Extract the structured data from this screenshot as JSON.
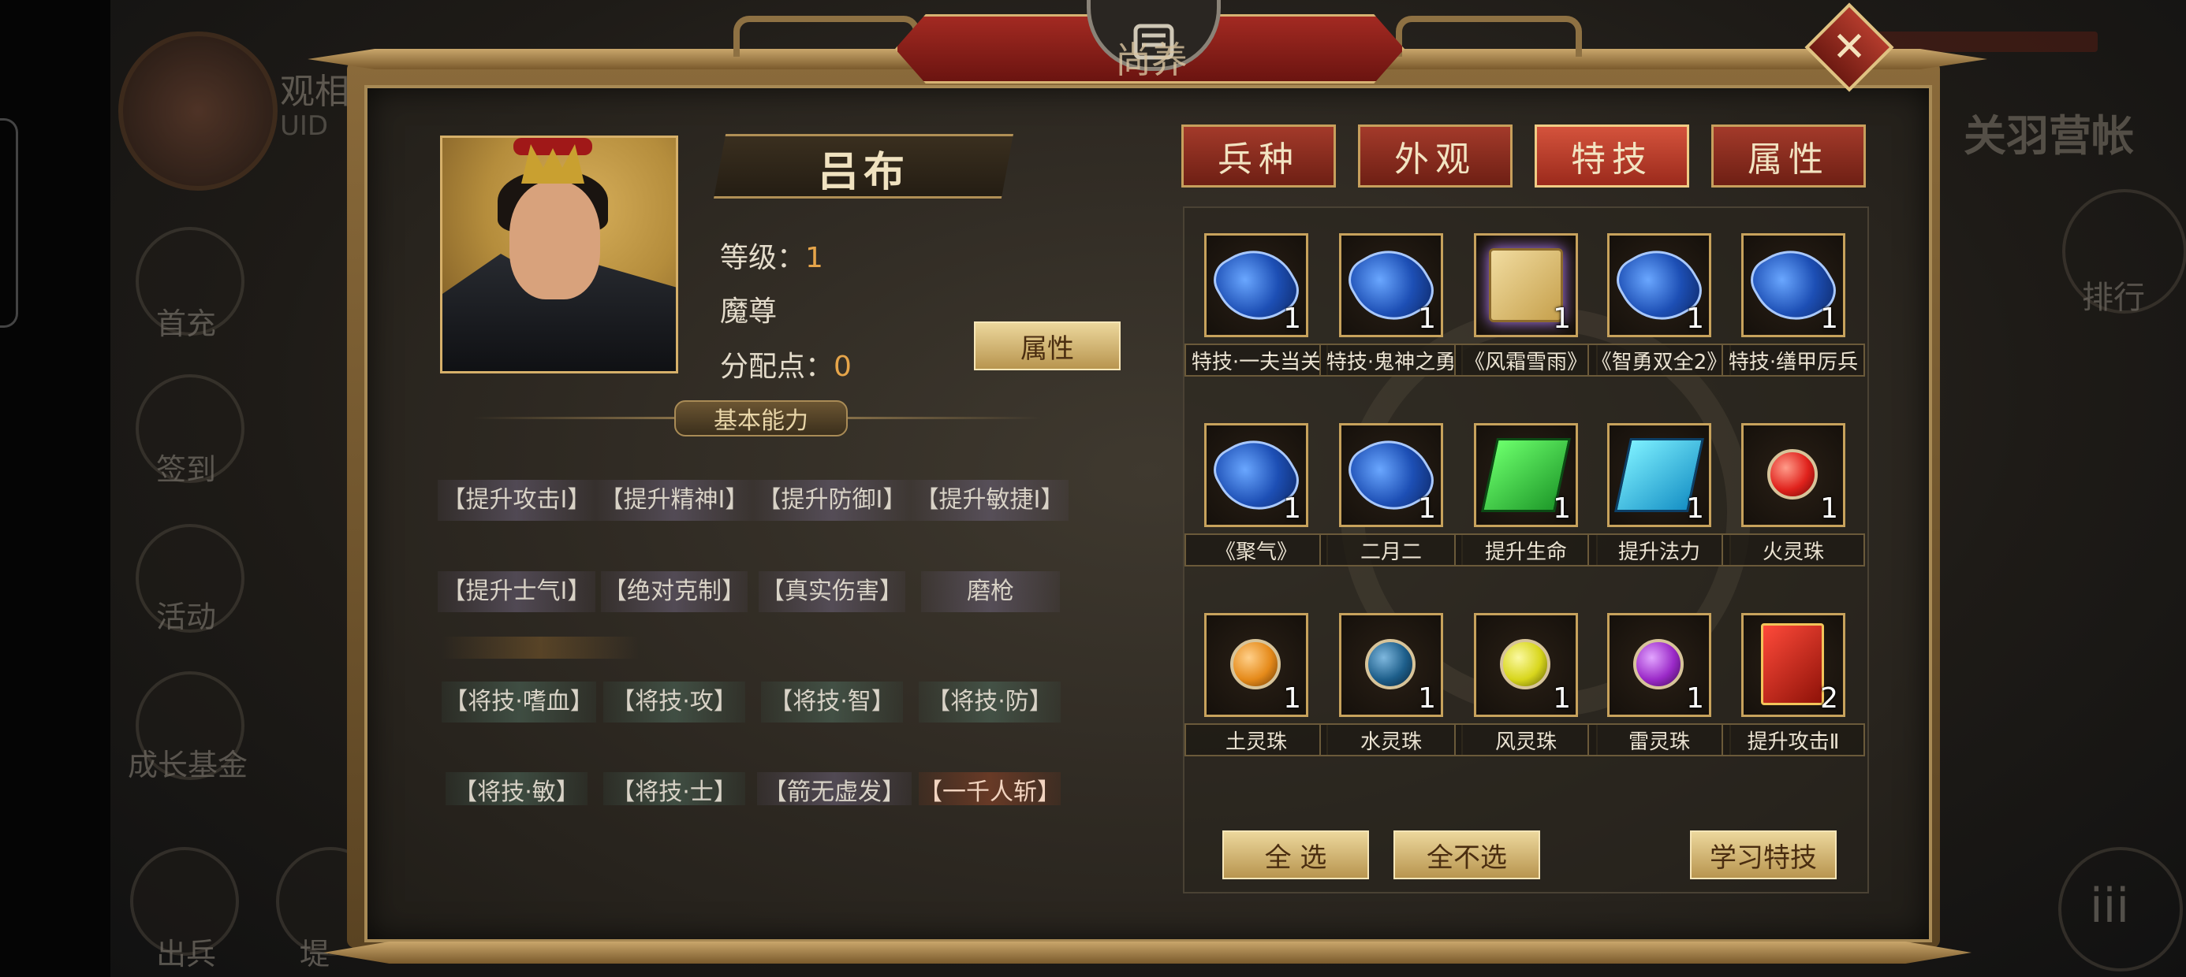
{
  "background": {
    "player_name": "观相",
    "player_uid_label": "UID",
    "menu_left": [
      "首充",
      "签到",
      "活动",
      "成长基金",
      "出兵",
      "堤"
    ],
    "right_title": "关羽营帐",
    "right_rank": "排行",
    "round_glyph": "iii"
  },
  "dialog": {
    "title": "尚养",
    "close_glyph": "✕"
  },
  "hero": {
    "name": "吕布",
    "level_label": "等级：",
    "level_value": "1",
    "title": "魔尊",
    "points_label": "分配点：",
    "points_value": "0",
    "attributes_button": "属性"
  },
  "basic_ability": {
    "header": "基本能力",
    "row1": [
      "【提升攻击Ⅰ】",
      "【提升精神Ⅰ】",
      "【提升防御Ⅰ】",
      "【提升敏捷Ⅰ】"
    ],
    "row2": [
      "【提升士气Ⅰ】",
      "【绝对克制】",
      "【真实伤害】",
      "磨枪"
    ],
    "row3": [
      "【将技·嗜血】",
      "【将技·攻】",
      "【将技·智】",
      "【将技·防】"
    ],
    "row4": [
      "【将技·敏】",
      "【将技·士】",
      "【箭无虚发】",
      "【一千人斩】"
    ]
  },
  "tabs": [
    {
      "label": "兵种",
      "active": false
    },
    {
      "label": "外观",
      "active": false
    },
    {
      "label": "特技",
      "active": true
    },
    {
      "label": "属性",
      "active": false
    }
  ],
  "items": [
    {
      "label": "特技·一夫当关",
      "count": "1",
      "icon": "blue-scroll-icon"
    },
    {
      "label": "特技·鬼神之勇",
      "count": "1",
      "icon": "blue-scroll-icon"
    },
    {
      "label": "《风霜雪雨》",
      "count": "1",
      "icon": "golden-book-icon"
    },
    {
      "label": "《智勇双全2》",
      "count": "1",
      "icon": "blue-scroll-icon"
    },
    {
      "label": "特技·缮甲厉兵",
      "count": "1",
      "icon": "blue-scroll-icon"
    },
    {
      "label": "《聚气》",
      "count": "1",
      "icon": "blue-scroll-icon"
    },
    {
      "label": "二月二",
      "count": "1",
      "icon": "blue-scroll-icon"
    },
    {
      "label": "提升生命",
      "count": "1",
      "icon": "green-book-icon"
    },
    {
      "label": "提升法力",
      "count": "1",
      "icon": "cyan-book-icon"
    },
    {
      "label": "火灵珠",
      "count": "1",
      "icon": "fire-orb-icon",
      "color": "#e0221c"
    },
    {
      "label": "土灵珠",
      "count": "1",
      "icon": "earth-orb-icon",
      "color": "#e58a1a"
    },
    {
      "label": "水灵珠",
      "count": "1",
      "icon": "water-orb-icon",
      "color": "#1d5e8a"
    },
    {
      "label": "风灵珠",
      "count": "1",
      "icon": "wind-orb-icon",
      "color": "#d8d61c"
    },
    {
      "label": "雷灵珠",
      "count": "1",
      "icon": "thunder-orb-icon",
      "color": "#9b2ac8"
    },
    {
      "label": "提升攻击Ⅱ",
      "count": "2",
      "icon": "red-book-icon"
    }
  ],
  "actions": {
    "select_all": "全 选",
    "select_none": "全不选",
    "learn": "学习特技"
  },
  "colors": {
    "tab_active": "#d4533c",
    "tab_normal": "#a33a2a",
    "gold_button": "#d9bd78",
    "value_orange": "#e6a54a"
  }
}
